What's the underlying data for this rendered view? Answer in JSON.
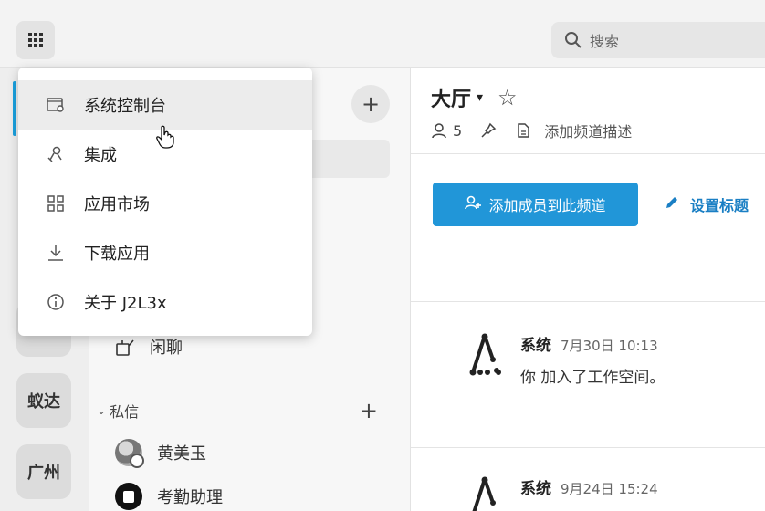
{
  "topbar": {
    "search_placeholder": "搜索"
  },
  "rail": {
    "workspaces": [
      "蚁达",
      "广州"
    ]
  },
  "channels": {
    "items": [
      {
        "label": "闲聊"
      }
    ],
    "dm_section": {
      "title": "私信"
    },
    "dms": [
      {
        "name": "黄美玉"
      },
      {
        "name": "考勤助理"
      }
    ]
  },
  "main": {
    "title": "大厅",
    "member_count": "5",
    "description_placeholder": "添加频道描述",
    "add_member_label": "添加成员到此频道",
    "set_topic_label": "设置标题",
    "messages": [
      {
        "author": "系统",
        "time": "7月30日 10:13",
        "text": "你 加入了工作空间。"
      },
      {
        "author": "系统",
        "time": "9月24日 15:24",
        "text": ""
      }
    ]
  },
  "menu": {
    "items": [
      {
        "label": "系统控制台",
        "icon": "console-icon",
        "highlighted": true
      },
      {
        "label": "集成",
        "icon": "integration-icon"
      },
      {
        "label": "应用市场",
        "icon": "marketplace-icon"
      },
      {
        "label": "下载应用",
        "icon": "download-icon"
      },
      {
        "label": "关于 J2L3x",
        "icon": "info-icon"
      }
    ]
  },
  "colors": {
    "accent": "#2196d8",
    "link": "#1a7fc4",
    "rail_indicator": "#1aa0de"
  }
}
